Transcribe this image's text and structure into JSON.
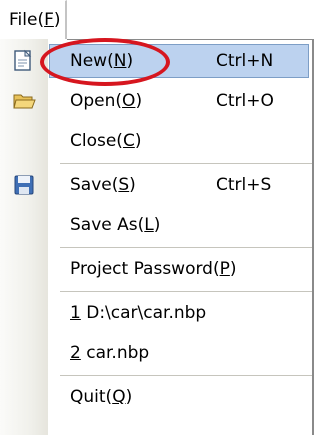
{
  "menubar": {
    "file_label": "File(",
    "file_mnemonic": "F",
    "file_suffix": ")"
  },
  "menu": {
    "items": [
      {
        "prefix": "New(",
        "mnemonic": "N",
        "suffix": ")",
        "shortcut": "Ctrl+N",
        "icon": "new-file-icon"
      },
      {
        "prefix": "Open(",
        "mnemonic": "O",
        "suffix": ")",
        "shortcut": "Ctrl+O",
        "icon": "open-folder-icon"
      },
      {
        "prefix": "Close(",
        "mnemonic": "C",
        "suffix": ")",
        "shortcut": ""
      },
      {
        "prefix": "Save(",
        "mnemonic": "S",
        "suffix": ")",
        "shortcut": "Ctrl+S",
        "icon": "save-disk-icon"
      },
      {
        "prefix": "Save As(",
        "mnemonic": "L",
        "suffix": ")",
        "shortcut": ""
      },
      {
        "prefix": "Project Password(",
        "mnemonic": "P",
        "suffix": ")",
        "shortcut": ""
      },
      {
        "prefix": "",
        "mnemonic": "1",
        "suffix": " D:\\car\\car.nbp",
        "shortcut": ""
      },
      {
        "prefix": "",
        "mnemonic": "2",
        "suffix": " car.nbp",
        "shortcut": ""
      },
      {
        "prefix": "Quit(",
        "mnemonic": "Q",
        "suffix": ")",
        "shortcut": ""
      }
    ]
  },
  "colors": {
    "highlight": "#bcd2ef",
    "annotation": "#d6161f"
  }
}
